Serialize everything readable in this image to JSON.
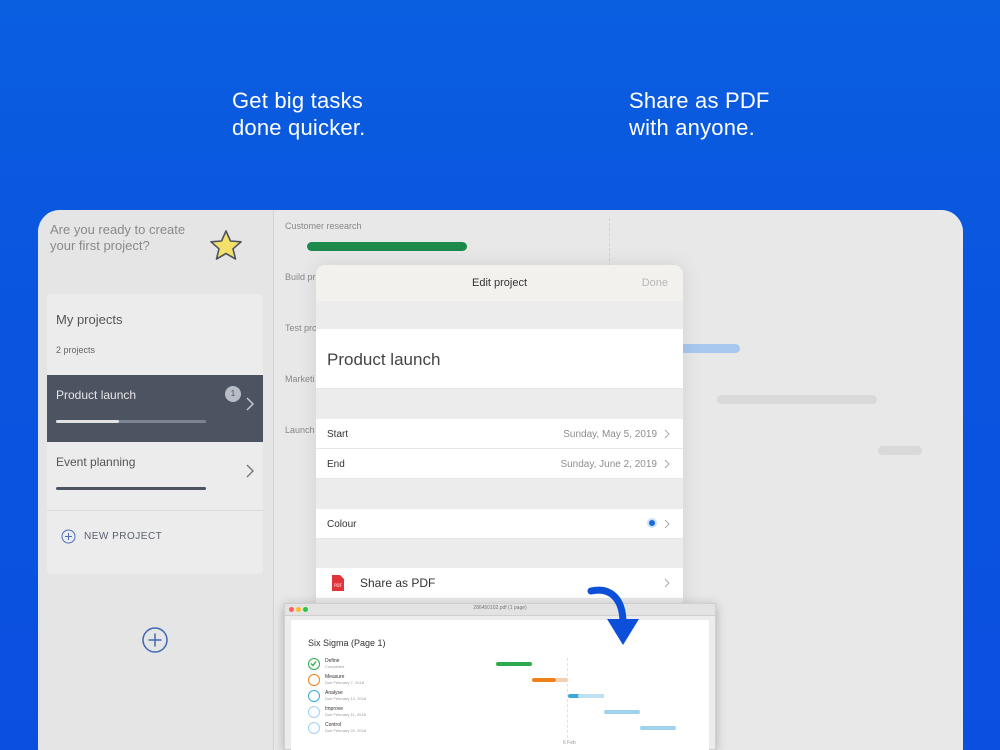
{
  "headlines": {
    "left": [
      "Get big tasks",
      "done quicker."
    ],
    "right": [
      "Share as PDF",
      "with anyone."
    ]
  },
  "sidebar": {
    "promo": "Are you ready to create your first project?",
    "card_title": "My projects",
    "card_count": "2 projects",
    "projects": [
      {
        "name": "Product launch",
        "badge": "1",
        "progress": 0.42,
        "active": true
      },
      {
        "name": "Event planning",
        "progress": 1.0,
        "active": false
      }
    ],
    "new_project": "NEW PROJECT"
  },
  "timeline": {
    "labels": [
      "Customer research",
      "Build pr",
      "Test pro",
      "Marketi",
      "Launch"
    ]
  },
  "modal": {
    "title": "Edit project",
    "done": "Done",
    "project_name": "Product launch",
    "start_label": "Start",
    "start_value": "Sunday, May 5, 2019",
    "end_label": "End",
    "end_value": "Sunday, June 2, 2019",
    "colour_label": "Colour",
    "share_label": "Share as PDF"
  },
  "pdf_window": {
    "file_title": "286450102.pdf (1 page)",
    "page_title": "Six Sigma (Page 1)",
    "axis_label": "6 Feb",
    "tasks": [
      {
        "name": "Define",
        "sub": "Completed",
        "color": "#2daa4f"
      },
      {
        "name": "Measure",
        "sub": "Due February 7, 2018",
        "color": "#f07f1a"
      },
      {
        "name": "Analyse",
        "sub": "Due February 12, 2018",
        "color": "#3aa8d8"
      },
      {
        "name": "Improve",
        "sub": "Due February 11, 2018",
        "color": "#9fd2ec"
      },
      {
        "name": "Control",
        "sub": "Due February 22, 2018",
        "color": "#9fd2ec"
      }
    ]
  },
  "colors": {
    "background": "#0a55e0",
    "accent": "#1a6ae0",
    "sidebar_active": "#4c5361"
  }
}
